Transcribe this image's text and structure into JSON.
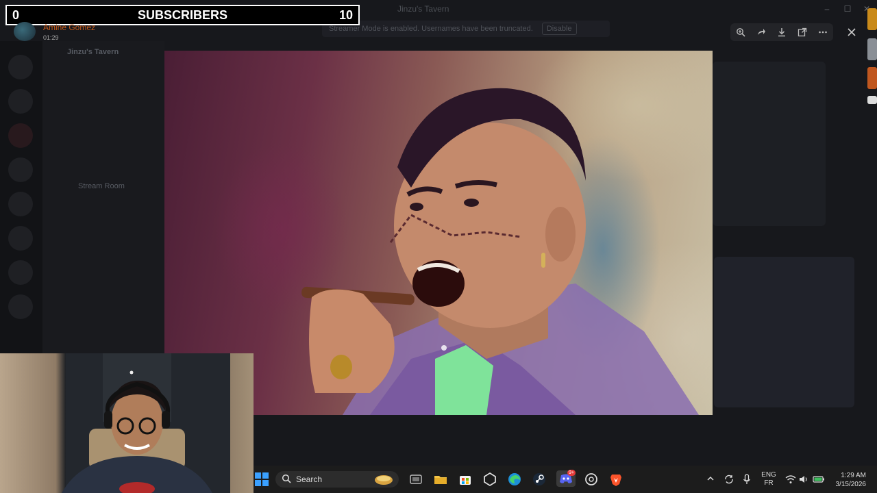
{
  "overlay": {
    "subscribers_current": "0",
    "subscribers_label": "SUBSCRIBERS",
    "subscribers_goal": "10"
  },
  "user_card": {
    "name": "Amine Gomez",
    "timestamp": "01:29"
  },
  "window": {
    "title": "Jinzu's Tavern"
  },
  "server": {
    "name": "Jinzu's Tavern",
    "channels": [
      "Stream Room"
    ]
  },
  "notice": {
    "text": "Streamer Mode is enabled. Usernames have been truncated.",
    "button": "Disable"
  },
  "viewer": {
    "tools": [
      "zoom-in-icon",
      "forward-icon",
      "download-icon",
      "open-external-icon",
      "more-icon"
    ],
    "close_icon": "close-icon"
  },
  "taskbar": {
    "search_label": "Search",
    "language": "ENG",
    "layout": "FR",
    "time": "1:29 AM",
    "date": "3/15/2026",
    "discord_badge": "9+"
  },
  "colors": {
    "overlay_border": "#ffffff",
    "username": "#c55a1a",
    "taskbar_bg": "#1c1c1c"
  }
}
